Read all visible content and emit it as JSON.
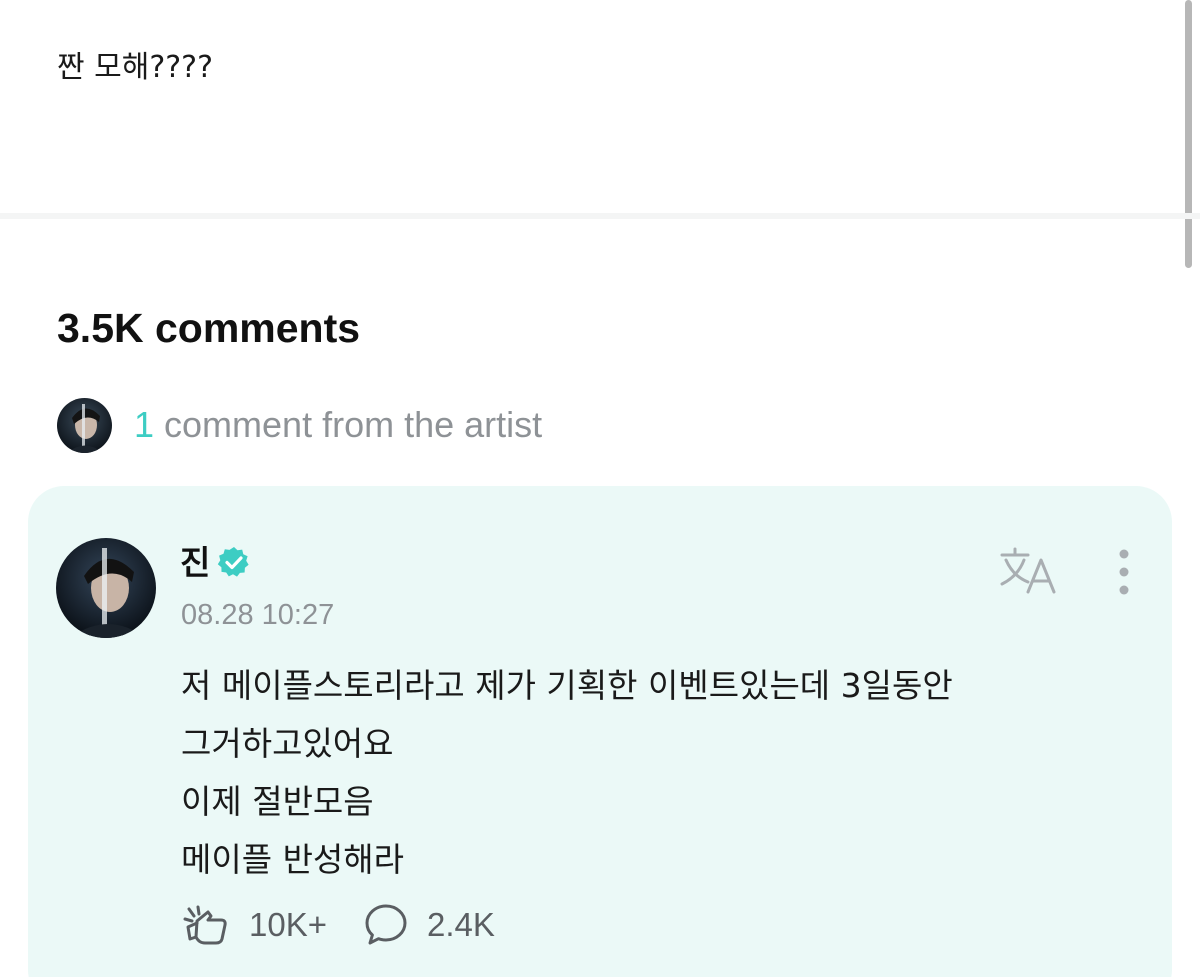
{
  "post": {
    "text": "짠 모해????"
  },
  "comments": {
    "count_label": "3.5K comments",
    "artist_row": {
      "count": "1",
      "label": " comment from the artist"
    }
  },
  "artist_comment": {
    "author": "진",
    "timestamp": "08.28 10:27",
    "lines": [
      "저 메이플스토리라고 제가 기획한 이벤트있는데 3일동안",
      "그거하고있어요",
      "이제 절반모음",
      "메이플 반성해라"
    ],
    "like_count": "10K+",
    "reply_count": "2.4K",
    "icons": {
      "verified": "verified-badge-icon",
      "translate": "translate-icon",
      "more": "more-vertical-icon",
      "like": "like-icon",
      "reply": "comment-bubble-icon"
    }
  },
  "colors": {
    "accent": "#3dcdc3",
    "card_background": "#ebf9f7",
    "muted_text": "#8e9296",
    "icon_gray": "#a9aeb2"
  }
}
